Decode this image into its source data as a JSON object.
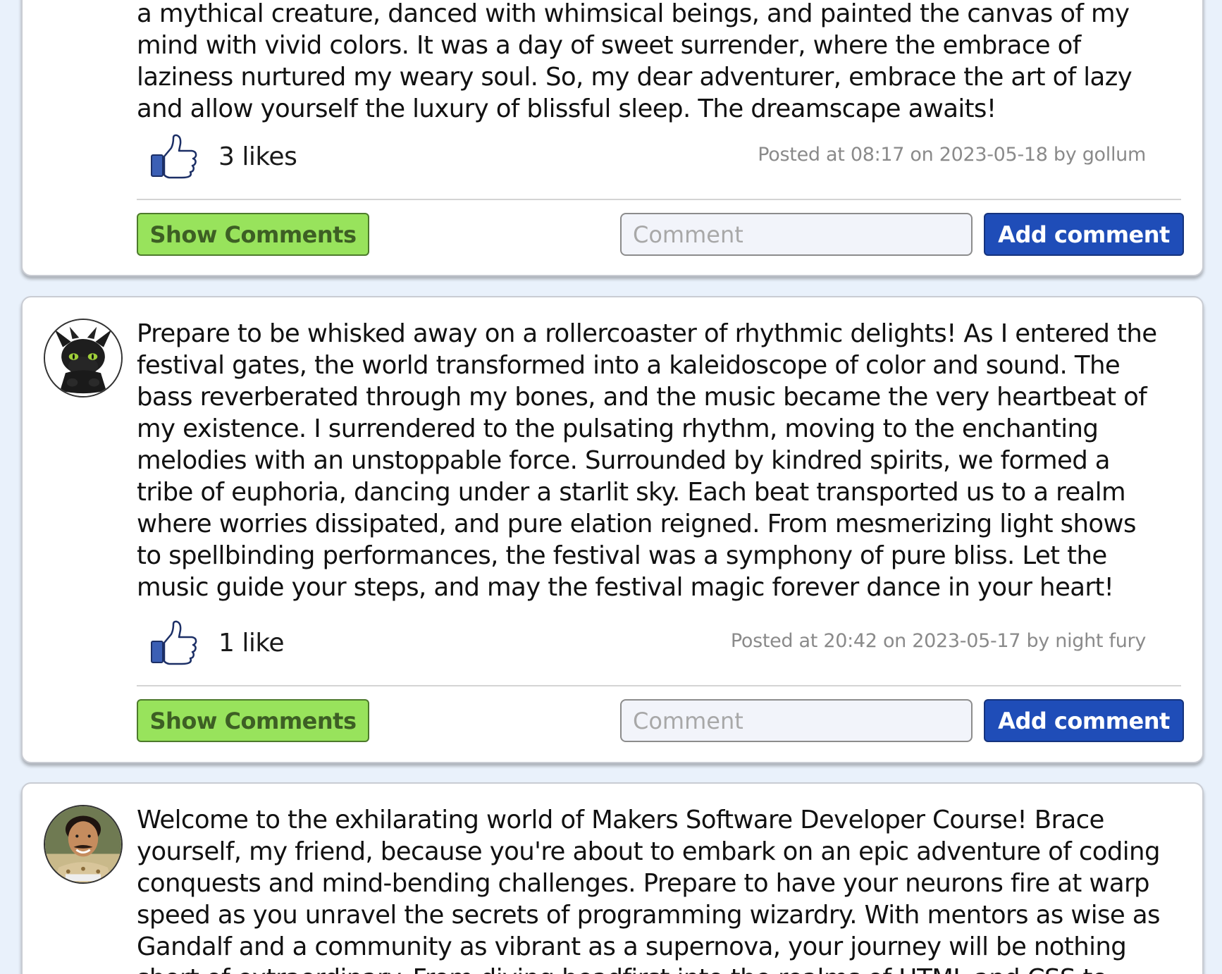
{
  "posts": [
    {
      "text": "a mythical creature, danced with whimsical beings, and painted the canvas of my\nmind with vivid colors. It was a day of sweet surrender, where the embrace of\nlaziness nurtured my weary soul. So, my dear adventurer, embrace the art of lazy\nand allow yourself the luxury of blissful sleep. The dreamscape awaits!",
      "likes_label": "3 likes",
      "posted": "Posted at 08:17 on 2023-05-18 by gollum",
      "show_comments_label": "Show Comments",
      "comment_placeholder": "Comment",
      "add_comment_label": "Add comment"
    },
    {
      "text": "Prepare to be whisked away on a rollercoaster of rhythmic delights! As I entered the\nfestival gates, the world transformed into a kaleidoscope of color and sound. The\nbass reverberated through my bones, and the music became the very heartbeat of\nmy existence. I surrendered to the pulsating rhythm, moving to the enchanting\nmelodies with an unstoppable force. Surrounded by kindred spirits, we formed a\ntribe of euphoria, dancing under a starlit sky. Each beat transported us to a realm\nwhere worries dissipated, and pure elation reigned. From mesmerizing light shows\nto spellbinding performances, the festival was a symphony of pure bliss. Let the\nmusic guide your steps, and may the festival magic forever dance in your heart!",
      "likes_label": "1 like",
      "posted": "Posted at 20:42 on 2023-05-17 by night fury",
      "show_comments_label": "Show Comments",
      "comment_placeholder": "Comment",
      "add_comment_label": "Add comment"
    },
    {
      "text": "Welcome to the exhilarating world of Makers Software Developer Course! Brace\nyourself, my friend, because you're about to embark on an epic adventure of coding\nconquests and mind-bending challenges. Prepare to have your neurons fire at warp\nspeed as you unravel the secrets of programming wizardry. With mentors as wise as\nGandalf and a community as vibrant as a supernova, your journey will be nothing\nshort of extraordinary. From diving headfirst into the realms of HTML and CSS to"
    }
  ],
  "colors": {
    "page_bg": "#e9f1fb",
    "show_comments_bg": "#98e35c",
    "add_comment_bg": "#1f4db8",
    "like_cuff": "#3b5fb5"
  },
  "icons": {
    "like": "thumbs-up-icon",
    "avatar_2": "night-fury-avatar",
    "avatar_3": "user-photo-avatar"
  }
}
